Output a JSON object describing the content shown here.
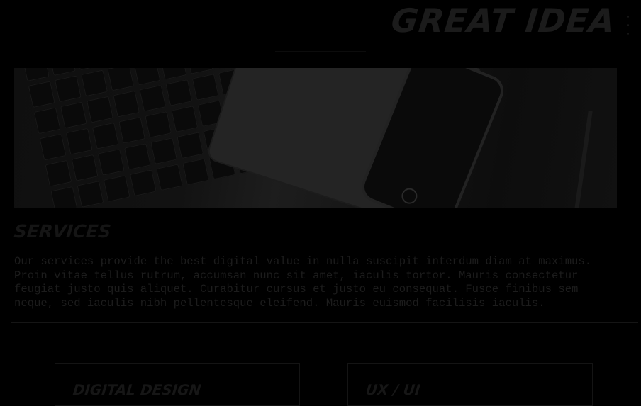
{
  "header": {
    "brand": "GREAT IDEA",
    "menu_icon": "kebab-menu-icon"
  },
  "hero": {
    "image_alt": "Desk with keyboard, tablet and smartphone"
  },
  "services": {
    "title": "SERVICES",
    "text": "Our services provide the best digital value in nulla suscipit interdum diam at maximus. Proin vitae tellus rutrum, accumsan nunc sit amet, iaculis tortor. Mauris consectetur feugiat justo quis aliquet. Curabitur cursus et justo eu consequat. Fusce finibus sem neque, sed iaculis nibh pellentesque eleifend. Mauris euismod facilisis iaculis."
  },
  "cards": [
    {
      "title": "DIGITAL DESIGN"
    },
    {
      "title": "UX / UI"
    }
  ]
}
